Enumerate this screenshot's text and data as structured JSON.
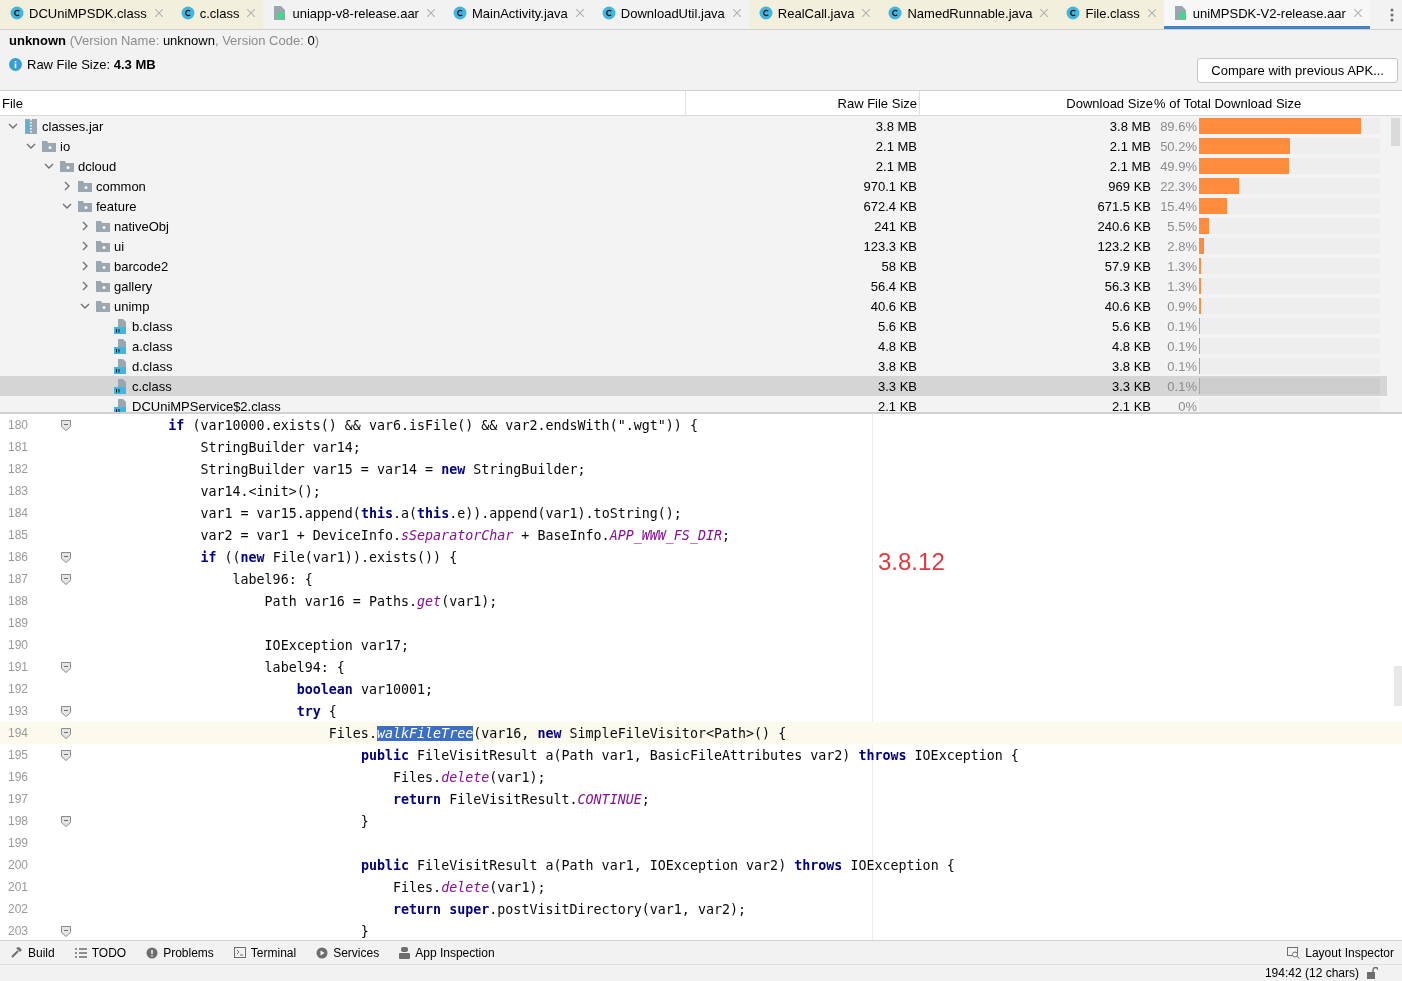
{
  "tabs": [
    {
      "label": "DCUniMPSDK.class",
      "kind": "class",
      "tinted": true,
      "selected": false
    },
    {
      "label": "c.class",
      "kind": "class",
      "tinted": true,
      "selected": false
    },
    {
      "label": "uniapp-v8-release.aar",
      "kind": "aar",
      "tinted": false,
      "selected": false
    },
    {
      "label": "MainActivity.java",
      "kind": "class",
      "tinted": false,
      "selected": false
    },
    {
      "label": "DownloadUtil.java",
      "kind": "class",
      "tinted": false,
      "selected": false
    },
    {
      "label": "RealCall.java",
      "kind": "class",
      "tinted": true,
      "selected": false
    },
    {
      "label": "NamedRunnable.java",
      "kind": "class",
      "tinted": true,
      "selected": false
    },
    {
      "label": "File.class",
      "kind": "class",
      "tinted": true,
      "selected": false
    },
    {
      "label": "uniMPSDK-V2-release.aar",
      "kind": "aar",
      "tinted": false,
      "selected": true
    }
  ],
  "header": {
    "app_name": "unknown",
    "version_parts": [
      {
        "text": "(Version Name: ",
        "kind": "label"
      },
      {
        "text": "unknown",
        "kind": "value"
      },
      {
        "text": ", Version Code: ",
        "kind": "label"
      },
      {
        "text": "0",
        "kind": "value"
      },
      {
        "text": ")",
        "kind": "label"
      }
    ],
    "raw_size": "Raw File Size: **4.3 MB**",
    "compare_button": "Compare with previous APK..."
  },
  "tree": {
    "columns": [
      "File",
      "Raw File Size",
      "Download Size",
      "% of Total Download Size"
    ],
    "nodes": [
      {
        "name": "classes.jar",
        "kind": "jar",
        "expanded": true,
        "selected": false,
        "raw": "3.8 MB",
        "download": "3.8 MB",
        "percent": "89.6%",
        "level": 0.896,
        "children": [
          {
            "name": "io",
            "kind": "folder",
            "expanded": true,
            "selected": false,
            "raw": "2.1 MB",
            "download": "2.1 MB",
            "percent": "50.2%",
            "level": 0.502,
            "children": [
              {
                "name": "dcloud",
                "kind": "folder",
                "expanded": true,
                "selected": false,
                "raw": "2.1 MB",
                "download": "2.1 MB",
                "percent": "49.9%",
                "level": 0.499,
                "children": [
                  {
                    "name": "common",
                    "kind": "folder",
                    "expanded": false,
                    "selected": false,
                    "raw": "970.1 KB",
                    "download": "969 KB",
                    "percent": "22.3%",
                    "level": 0.223
                  },
                  {
                    "name": "feature",
                    "kind": "folder",
                    "expanded": true,
                    "selected": false,
                    "raw": "672.4 KB",
                    "download": "671.5 KB",
                    "percent": "15.4%",
                    "level": 0.154,
                    "children": [
                      {
                        "name": "nativeObj",
                        "kind": "folder",
                        "expanded": false,
                        "selected": false,
                        "raw": "241 KB",
                        "download": "240.6 KB",
                        "percent": "5.5%",
                        "level": 0.055
                      },
                      {
                        "name": "ui",
                        "kind": "folder",
                        "expanded": false,
                        "selected": false,
                        "raw": "123.3 KB",
                        "download": "123.2 KB",
                        "percent": "2.8%",
                        "level": 0.028
                      },
                      {
                        "name": "barcode2",
                        "kind": "folder",
                        "expanded": false,
                        "selected": false,
                        "raw": "58 KB",
                        "download": "57.9 KB",
                        "percent": "1.3%",
                        "level": 0.013
                      },
                      {
                        "name": "gallery",
                        "kind": "folder",
                        "expanded": false,
                        "selected": false,
                        "raw": "56.4 KB",
                        "download": "56.3 KB",
                        "percent": "1.3%",
                        "level": 0.013
                      },
                      {
                        "name": "unimp",
                        "kind": "folder",
                        "expanded": true,
                        "selected": false,
                        "raw": "40.6 KB",
                        "download": "40.6 KB",
                        "percent": "0.9%",
                        "level": 0.009,
                        "children": [
                          {
                            "name": "b.class",
                            "kind": "class",
                            "selected": false,
                            "raw": "5.6 KB",
                            "download": "5.6 KB",
                            "percent": "0.1%",
                            "level": 0.001
                          },
                          {
                            "name": "a.class",
                            "kind": "class",
                            "selected": false,
                            "raw": "4.8 KB",
                            "download": "4.8 KB",
                            "percent": "0.1%",
                            "level": 0.001
                          },
                          {
                            "name": "d.class",
                            "kind": "class",
                            "selected": false,
                            "raw": "3.8 KB",
                            "download": "3.8 KB",
                            "percent": "0.1%",
                            "level": 0.001
                          },
                          {
                            "name": "c.class",
                            "kind": "class",
                            "selected": true,
                            "raw": "3.3 KB",
                            "download": "3.3 KB",
                            "percent": "0.1%",
                            "level": 0.001
                          },
                          {
                            "name": "DCUniMPService$2.class",
                            "kind": "class",
                            "selected": false,
                            "raw": "2.1 KB",
                            "download": "2.1 KB",
                            "percent": "0%"
                          }
                        ]
                      }
                    ]
                  }
                ]
              }
            ]
          }
        ]
      }
    ]
  },
  "editor": {
    "annotation": "3.8.12",
    "lines": [
      {
        "number": "180",
        "fold": true,
        "current": false,
        "text": "            **if** (var10000.exists() && var6.isFile() && var2.endsWith(\".wgt\")) {"
      },
      {
        "number": "181",
        "fold": false,
        "current": false,
        "text": "                StringBuilder var14;"
      },
      {
        "number": "182",
        "fold": false,
        "current": false,
        "text": "                StringBuilder var15 = var14 = **new** StringBuilder;"
      },
      {
        "number": "183",
        "fold": false,
        "current": false,
        "text": "                var14.<init>();"
      },
      {
        "number": "184",
        "fold": false,
        "current": false,
        "text": "                var1 = var15.append(**this**.a(**this**.e)).append(var1).toString();"
      },
      {
        "number": "185",
        "fold": false,
        "current": false,
        "text": "                var2 = var1 + DeviceInfo.*sSeparatorChar* + BaseInfo.*APP_WWW_FS_DIR*;"
      },
      {
        "number": "186",
        "fold": true,
        "current": false,
        "text": "                **if** ((**new** File(var1)).exists()) {"
      },
      {
        "number": "187",
        "fold": true,
        "current": false,
        "text": "                    label96: {"
      },
      {
        "number": "188",
        "fold": false,
        "current": false,
        "text": "                        Path var16 = Paths.*get*(var1);"
      },
      {
        "number": "189",
        "fold": false,
        "current": false
      },
      {
        "number": "190",
        "fold": false,
        "current": false,
        "text": "                        IOException var17;"
      },
      {
        "number": "191",
        "fold": true,
        "current": false,
        "text": "                        label94: {"
      },
      {
        "number": "192",
        "fold": false,
        "current": false,
        "text": "                            **boolean** var10001;"
      },
      {
        "number": "193",
        "fold": true,
        "current": false,
        "text": "                            **try** {"
      },
      {
        "number": "194",
        "fold": true,
        "current": true,
        "text": "                                Files.*walkFileTree*(var16, **new** SimpleFileVisitor<Path>() {"
      },
      {
        "number": "195",
        "fold": true,
        "current": false,
        "text": "                                    **public** FileVisitResult a(Path var1, BasicFileAttributes var2) **throws** IOException {"
      },
      {
        "number": "196",
        "fold": false,
        "current": false,
        "text": "                                        Files.*delete*(var1);"
      },
      {
        "number": "197",
        "fold": false,
        "current": false,
        "text": "                                        **return** FileVisitResult.*CONTINUE*;"
      },
      {
        "number": "198",
        "fold": true,
        "current": false,
        "text": "                                    }"
      },
      {
        "number": "199",
        "fold": false,
        "current": false
      },
      {
        "number": "200",
        "fold": false,
        "current": false,
        "text": "                                    **public** FileVisitResult a(Path var1, IOException var2) **throws** IOException {"
      },
      {
        "number": "201",
        "fold": false,
        "current": false,
        "text": "                                        Files.*delete*(var1);"
      },
      {
        "number": "202",
        "fold": false,
        "current": false,
        "text": "                                        **return** **super**.postVisitDirectory(var1, var2);"
      },
      {
        "number": "203",
        "fold": true,
        "current": false,
        "text": "                                    }"
      }
    ]
  },
  "tool_buttons": [
    {
      "label": "Build",
      "kind": "hammer"
    },
    {
      "label": "TODO",
      "kind": "list"
    },
    {
      "label": "Problems",
      "kind": "problems"
    },
    {
      "label": "Terminal",
      "kind": "terminal"
    },
    {
      "label": "Services",
      "kind": "services"
    },
    {
      "label": "App Inspection",
      "kind": "inspection"
    }
  ],
  "tool_buttons_right": [
    {
      "label": "Layout Inspector",
      "kind": "layout"
    }
  ],
  "status": {
    "position": "194:42 (12 chars)"
  }
}
